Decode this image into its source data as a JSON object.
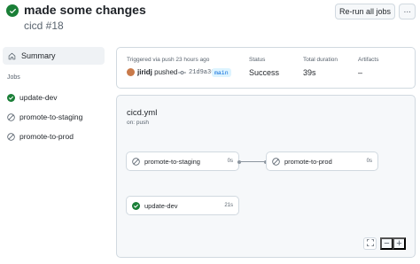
{
  "header": {
    "title": "made some changes",
    "subtitle": "cicd #18",
    "rerun_label": "Re-run all jobs",
    "more_label": "···"
  },
  "sidebar": {
    "summary_label": "Summary",
    "jobs_heading": "Jobs",
    "jobs": [
      {
        "label": "update-dev",
        "status": "success"
      },
      {
        "label": "promote-to-staging",
        "status": "skipped"
      },
      {
        "label": "promote-to-prod",
        "status": "skipped"
      }
    ]
  },
  "summary": {
    "trigger_label": "Triggered via push 23 hours ago",
    "actor": "jiridj",
    "action": "pushed",
    "commit": "21d9a36",
    "branch": "main",
    "status_label": "Status",
    "status_value": "Success",
    "duration_label": "Total duration",
    "duration_value": "39s",
    "artifacts_label": "Artifacts",
    "artifacts_value": "–"
  },
  "graph": {
    "workflow_file": "cicd.yml",
    "trigger": "on: push",
    "jobs": [
      {
        "name": "promote-to-staging",
        "duration": "0s",
        "status": "skipped"
      },
      {
        "name": "promote-to-prod",
        "duration": "0s",
        "status": "skipped"
      },
      {
        "name": "update-dev",
        "duration": "21s",
        "status": "success"
      }
    ],
    "zoom_fit_icon": "fullscreen-icon",
    "zoom_out_label": "−",
    "zoom_in_label": "+"
  },
  "colors": {
    "success": "#1a7f37",
    "muted": "#59636e",
    "link": "#0969da"
  }
}
